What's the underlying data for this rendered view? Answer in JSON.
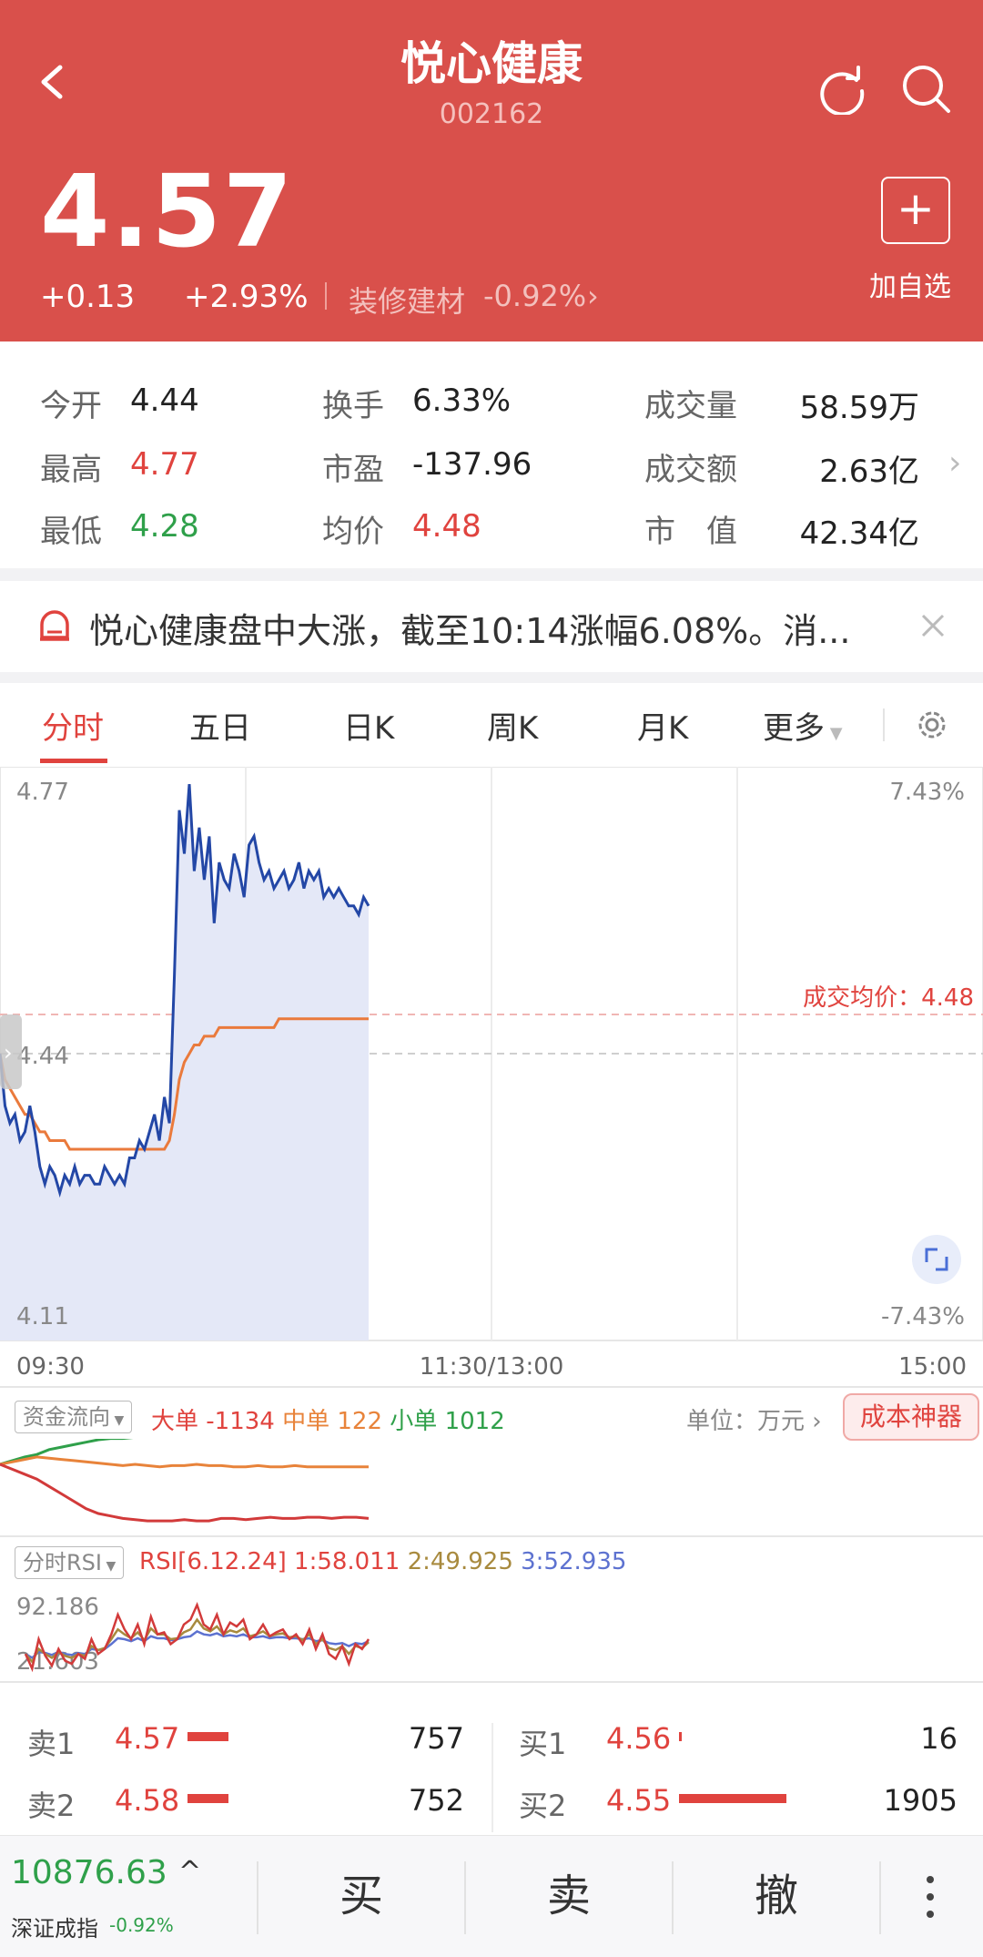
{
  "header": {
    "title": "悦心健康",
    "code": "002162",
    "price": "4.57",
    "change": "+0.13",
    "change_pct": "+2.93%",
    "sector_label": "装修建材",
    "sector_change": "-0.92%",
    "add_label": "加自选",
    "bg_color": "#d9504b"
  },
  "quote": {
    "open_label": "今开",
    "open": "4.44",
    "high_label": "最高",
    "high": "4.77",
    "low_label": "最低",
    "low": "4.28",
    "turnover_label": "换手",
    "turnover": "6.33%",
    "pe_label": "市盈",
    "pe": "-137.96",
    "avg_label": "均价",
    "avg": "4.48",
    "volume_label": "成交量",
    "volume": "58.59万",
    "amount_label": "成交额",
    "amount": "2.63亿",
    "mcap_label": "市　值",
    "mcap": "42.34亿"
  },
  "news": {
    "text": "悦心健康盘中大涨，截至10:14涨幅6.08%。消..."
  },
  "tabs": [
    "分时",
    "五日",
    "日K",
    "周K",
    "月K",
    "更多"
  ],
  "chart": {
    "y_top": "4.77",
    "y_mid": "4.44",
    "y_bottom": "4.11",
    "pct_top": "7.43%",
    "pct_bottom": "-7.43%",
    "avg_line_label": "成交均价：4.48",
    "time_start": "09:30",
    "time_mid": "11:30/13:00",
    "time_end": "15:00"
  },
  "chart_data": {
    "type": "line",
    "title": "",
    "ylim": [
      4.11,
      4.77
    ],
    "x_range": [
      "09:30",
      "15:00"
    ],
    "series": [
      {
        "values": [
          4.44,
          4.38,
          4.36,
          4.37,
          4.34,
          4.35,
          4.38,
          4.35,
          4.31,
          4.29,
          4.31,
          4.3,
          4.28,
          4.3,
          4.29,
          4.31,
          4.29,
          4.3,
          4.3,
          4.29,
          4.29,
          4.31,
          4.3,
          4.29,
          4.3,
          4.29,
          4.32,
          4.32,
          4.34,
          4.33,
          4.35,
          4.37,
          4.34,
          4.39,
          4.36,
          4.53,
          4.72,
          4.67,
          4.75,
          4.65,
          4.7,
          4.64,
          4.69,
          4.59,
          4.66,
          4.64,
          4.63,
          4.67,
          4.65,
          4.62,
          4.68,
          4.69,
          4.66,
          4.64,
          4.65,
          4.63,
          4.64,
          4.65,
          4.63,
          4.64,
          4.66,
          4.63,
          4.65,
          4.64,
          4.65,
          4.62,
          4.63,
          4.62,
          4.63,
          4.62,
          4.61,
          4.61,
          4.6,
          4.62,
          4.61
        ]
      },
      {
        "values": [
          4.44,
          4.41,
          4.4,
          4.39,
          4.38,
          4.37,
          4.37,
          4.36,
          4.35,
          4.35,
          4.34,
          4.34,
          4.34,
          4.34,
          4.33,
          4.33,
          4.33,
          4.33,
          4.33,
          4.33,
          4.33,
          4.33,
          4.33,
          4.33,
          4.33,
          4.33,
          4.33,
          4.33,
          4.33,
          4.33,
          4.33,
          4.33,
          4.33,
          4.33,
          4.34,
          4.37,
          4.41,
          4.43,
          4.44,
          4.45,
          4.45,
          4.46,
          4.46,
          4.46,
          4.47,
          4.47,
          4.47,
          4.47,
          4.47,
          4.47,
          4.47,
          4.47,
          4.47,
          4.47,
          4.47,
          4.47,
          4.48,
          4.48,
          4.48,
          4.48,
          4.48,
          4.48,
          4.48,
          4.48,
          4.48,
          4.48,
          4.48,
          4.48,
          4.48,
          4.48,
          4.48,
          4.48,
          4.48,
          4.48,
          4.48
        ]
      }
    ],
    "total_points": 241,
    "avg_price": 4.48,
    "prev_close": 4.44
  },
  "money_flow": {
    "selector": "资金流向",
    "big_label": "大单",
    "big": "-1134",
    "mid_label": "中单",
    "mid": "122",
    "small_label": "小单",
    "small": "1012",
    "unit": "单位：万元",
    "tool_button": "成本神器",
    "series": {
      "big": [
        0,
        -4,
        -8,
        -12,
        -18,
        -24,
        -30,
        -36,
        -40,
        -42,
        -44,
        -45,
        -46,
        -46,
        -46,
        -45,
        -46,
        -46,
        -44,
        -44,
        -45,
        -44,
        -43,
        -44,
        -44,
        -43,
        -43,
        -44,
        -43,
        -43,
        -44
      ],
      "mid": [
        0,
        2,
        4,
        6,
        5,
        4,
        3,
        2,
        1,
        0,
        -1,
        0,
        -1,
        -2,
        -1,
        -1,
        0,
        -1,
        -1,
        -2,
        -2,
        -1,
        -2,
        -2,
        -1,
        -2,
        -2,
        -2,
        -2,
        -2,
        -2
      ],
      "small": [
        0,
        3,
        6,
        8,
        12,
        14,
        16,
        18,
        20,
        21,
        21,
        22,
        22,
        23,
        24,
        23,
        24,
        25,
        24,
        24,
        25,
        24,
        23,
        24,
        24,
        23,
        24,
        24,
        24,
        25,
        25
      ]
    }
  },
  "rsi": {
    "selector": "分时RSI",
    "params": "RSI[6.12.24]",
    "r1": "1:58.011",
    "r2": "2:49.925",
    "r3": "3:52.935",
    "y_top": "92.186",
    "y_bottom": "21.603",
    "ylim": [
      21.603,
      92.186
    ],
    "series": {
      "r1": [
        40,
        25,
        55,
        38,
        28,
        45,
        33,
        30,
        40,
        35,
        55,
        40,
        45,
        60,
        80,
        65,
        55,
        70,
        50,
        78,
        60,
        62,
        50,
        55,
        70,
        75,
        90,
        70,
        65,
        80,
        60,
        72,
        68,
        75,
        55,
        60,
        70,
        58,
        62,
        65,
        55,
        60,
        50,
        65,
        45,
        60,
        40,
        35,
        48,
        30,
        50,
        45,
        55
      ],
      "r2": [
        40,
        32,
        45,
        40,
        36,
        42,
        38,
        36,
        40,
        38,
        48,
        44,
        46,
        55,
        65,
        60,
        56,
        62,
        54,
        66,
        60,
        60,
        55,
        56,
        62,
        65,
        75,
        66,
        63,
        68,
        60,
        64,
        62,
        66,
        58,
        60,
        63,
        58,
        60,
        61,
        57,
        58,
        54,
        60,
        50,
        55,
        46,
        44,
        48,
        40,
        48,
        46,
        52
      ],
      "r3": [
        40,
        36,
        42,
        41,
        39,
        42,
        40,
        39,
        41,
        40,
        45,
        44,
        45,
        50,
        56,
        55,
        53,
        56,
        53,
        58,
        56,
        56,
        54,
        55,
        57,
        58,
        63,
        60,
        59,
        61,
        58,
        59,
        58,
        60,
        57,
        57,
        58,
        56,
        57,
        57,
        56,
        56,
        55,
        56,
        53,
        54,
        51,
        50,
        51,
        48,
        51,
        50,
        53
      ]
    }
  },
  "orderbook": {
    "sell": [
      {
        "label": "卖1",
        "price": "4.57",
        "volume": "757"
      },
      {
        "label": "卖2",
        "price": "4.58",
        "volume": "752"
      }
    ],
    "buy": [
      {
        "label": "买1",
        "price": "4.56",
        "volume": "16"
      },
      {
        "label": "买2",
        "price": "4.55",
        "volume": "1905"
      }
    ],
    "volume_scale": 1905
  },
  "bottom": {
    "index_value": "10876.63",
    "index_name": "深证成指",
    "index_change": "-0.92%",
    "buy": "买",
    "sell": "卖",
    "cancel": "撤"
  }
}
